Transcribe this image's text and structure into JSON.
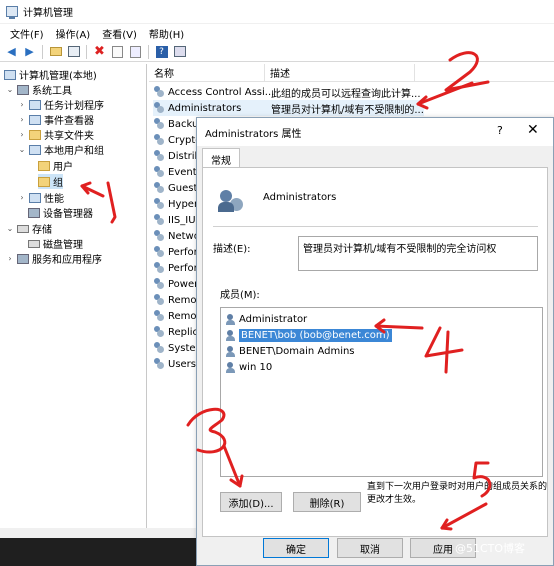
{
  "window": {
    "title": "计算机管理"
  },
  "menu": [
    "文件(F)",
    "操作(A)",
    "查看(V)",
    "帮助(H)"
  ],
  "toolbar": [
    "back-arrow-icon",
    "forward-arrow-icon",
    "folder-up-icon",
    "show-tree-icon",
    "delete-icon",
    "properties-icon",
    "export-icon",
    "help-icon",
    "console-icon"
  ],
  "tree": [
    {
      "label": "计算机管理(本地)",
      "icon": "computer-icon"
    },
    {
      "label": "系统工具",
      "icon": "tools-icon"
    },
    {
      "label": "任务计划程序",
      "icon": "clock-icon"
    },
    {
      "label": "事件查看器",
      "icon": "event-icon"
    },
    {
      "label": "共享文件夹",
      "icon": "share-icon"
    },
    {
      "label": "本地用户和组",
      "icon": "users-icon"
    },
    {
      "label": "用户",
      "icon": "folder-icon"
    },
    {
      "label": "组",
      "icon": "folder-icon"
    },
    {
      "label": "性能",
      "icon": "perf-icon"
    },
    {
      "label": "设备管理器",
      "icon": "device-icon"
    },
    {
      "label": "存储",
      "icon": "storage-icon"
    },
    {
      "label": "磁盘管理",
      "icon": "disk-icon"
    },
    {
      "label": "服务和应用程序",
      "icon": "services-icon"
    }
  ],
  "list": {
    "col_name": "名称",
    "col_desc": "描述",
    "rows": [
      {
        "name": "Access Control Assi...",
        "desc": "此组的成员可以远程查询此计算..."
      },
      {
        "name": "Administrators",
        "desc": "管理员对计算机/域有不受限制的..."
      },
      {
        "name": "Backup",
        "desc": ""
      },
      {
        "name": "Crypto",
        "desc": ""
      },
      {
        "name": "Distrib",
        "desc": ""
      },
      {
        "name": "Event",
        "desc": ""
      },
      {
        "name": "Guests",
        "desc": ""
      },
      {
        "name": "Hyper-",
        "desc": ""
      },
      {
        "name": "IIS_IUS",
        "desc": ""
      },
      {
        "name": "Netwo",
        "desc": ""
      },
      {
        "name": "Perfor",
        "desc": ""
      },
      {
        "name": "Perfor",
        "desc": ""
      },
      {
        "name": "Power",
        "desc": ""
      },
      {
        "name": "Remot",
        "desc": ""
      },
      {
        "name": "Remot",
        "desc": ""
      },
      {
        "name": "Replica",
        "desc": ""
      },
      {
        "name": "System",
        "desc": ""
      },
      {
        "name": "Users",
        "desc": ""
      }
    ]
  },
  "dialog": {
    "title": "Administrators 属性",
    "help": "?",
    "close": "✕",
    "tab": "常规",
    "group_name": "Administrators",
    "desc_label": "描述(E):",
    "desc_value": "管理员对计算机/域有不受限制的完全访问权",
    "members_label": "成员(M):",
    "members": [
      "Administrator",
      "BENET\\bob (bob@benet.com)",
      "BENET\\Domain Admins",
      "win 10"
    ],
    "add": "添加(D)...",
    "remove": "删除(R)",
    "note": "直到下一次用户登录时对用户的组成员关系的更改才生效。",
    "ok": "确定",
    "cancel": "取消",
    "apply": "应用"
  },
  "annotations": [
    "1",
    "2",
    "3",
    "4",
    "5"
  ],
  "watermark": "@51CTO博客"
}
